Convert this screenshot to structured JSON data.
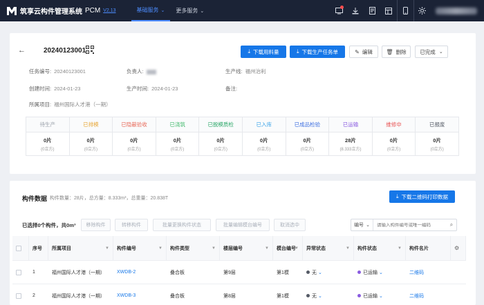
{
  "app": {
    "name": "筑享云构件管理系统",
    "product": "PCM",
    "version": "V2.13"
  },
  "nav": [
    {
      "label": "基础服务",
      "active": true
    },
    {
      "label": "更多服务",
      "active": false
    }
  ],
  "task": {
    "id": "20240123001",
    "buttons": {
      "download_material": "下载用料量",
      "download_task": "下载生产任务单",
      "edit": "编辑",
      "delete": "删除",
      "status_select": "已完成"
    },
    "info": {
      "task_no_label": "任务编号:",
      "task_no_value": "20240123001",
      "owner_label": "负责人:",
      "line_label": "生产线:",
      "line_value": "福州治利",
      "created_label": "创建时间:",
      "created_value": "2024-01-23",
      "produce_label": "生产时间:",
      "produce_value": "2024-01-23",
      "remark_label": "备注:",
      "project_label": "所属项目:",
      "project_value": "福州国际人才港（一期）"
    }
  },
  "stages": [
    {
      "name": "待生产",
      "color": "#9aa0aa",
      "count": "0片",
      "volume": "(0立方)"
    },
    {
      "name": "已排模",
      "color": "#e8a83a",
      "count": "0片",
      "volume": "(0立方)"
    },
    {
      "name": "已隐蔽验收",
      "color": "#e86a5a",
      "count": "0片",
      "volume": "(0立方)"
    },
    {
      "name": "已浇筑",
      "color": "#3fb86a",
      "count": "0片",
      "volume": "(0立方)"
    },
    {
      "name": "已脱模质检",
      "color": "#2ea86a",
      "count": "0片",
      "volume": "(0立方)"
    },
    {
      "name": "已入库",
      "color": "#3aa3e8",
      "count": "0片",
      "volume": "(0立方)"
    },
    {
      "name": "已成品检验",
      "color": "#3d6fe0",
      "count": "0片",
      "volume": "(0立方)"
    },
    {
      "name": "已运输",
      "color": "#8a5ce0",
      "count": "28片",
      "volume": "(8.333立方)"
    },
    {
      "name": "维修中",
      "color": "#e85050",
      "count": "0片",
      "volume": "(0立方)"
    },
    {
      "name": "已报废",
      "color": "#555b66",
      "count": "0片",
      "volume": "(0立方)"
    }
  ],
  "components": {
    "title": "构件数据",
    "stats": "构件数量：28片，总方量：8.333m³，总重量：20.838T",
    "download_qr": "下载二维码打印数据",
    "selected": "已选择0个构件，共0m³",
    "actions": [
      "移除构件",
      "转移构件",
      "批量更换构件状态",
      "批量编辑模台编号",
      "取消选中"
    ],
    "search": {
      "field": "编号",
      "placeholder": "请输入构件编号或唯一编码"
    },
    "columns": [
      "序号",
      "所属项目",
      "构件编号",
      "构件类型",
      "楼层编号",
      "模台编号",
      "异常状态",
      "构件状态",
      "构件名片"
    ],
    "rows": [
      {
        "seq": "1",
        "project": "福州国际人才港（一期）",
        "code": "XWDB-2",
        "type": "叠合板",
        "floor": "第9层",
        "platform": "第1模",
        "abnormal": "无",
        "status": "已运输",
        "card": "二维码"
      },
      {
        "seq": "2",
        "project": "福州国际人才港（一期）",
        "code": "XWDB-3",
        "type": "叠合板",
        "floor": "第8层",
        "platform": "第1模",
        "abnormal": "无",
        "status": "已运输",
        "card": "二维码"
      }
    ]
  },
  "colors": {
    "primary": "#1677e8",
    "topbar": "#1b2336",
    "status_transport": "#8a5ce0",
    "abnormal_none": "#555b66"
  }
}
